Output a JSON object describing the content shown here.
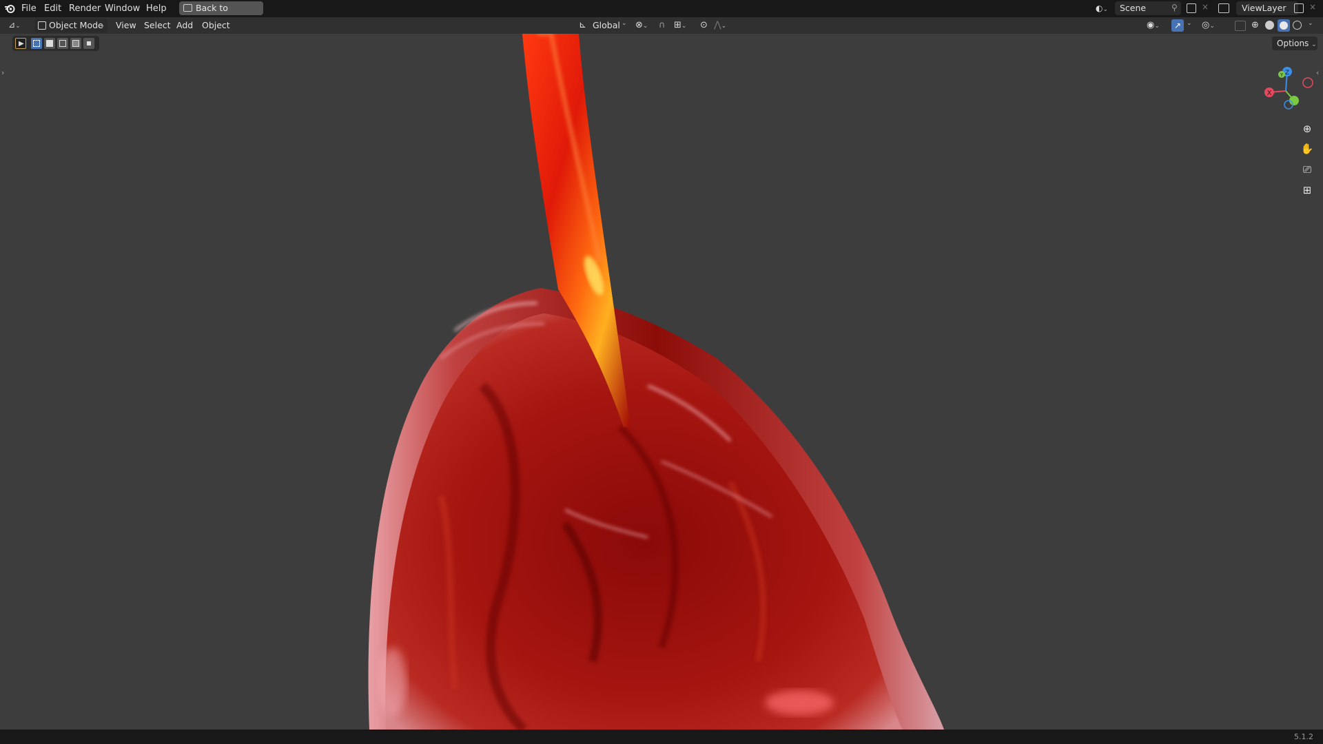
{
  "menubar": {
    "items": [
      "File",
      "Edit",
      "Render",
      "Window",
      "Help"
    ],
    "back_button": "Back to Previous",
    "scene": "Scene",
    "view_layer": "ViewLayer"
  },
  "header": {
    "mode": "Object Mode",
    "menus": [
      "View",
      "Select",
      "Add",
      "Object"
    ],
    "orientation": "Global",
    "options": "Options"
  },
  "gizmo": {
    "x": "X",
    "y": "Y",
    "z": "Z"
  },
  "status": {
    "version": "5.1.2"
  },
  "colors": {
    "accent": "#4772b3",
    "gizmo_x": "#e5495e",
    "gizmo_y": "#7ac943",
    "gizmo_z": "#3c8ee6"
  }
}
